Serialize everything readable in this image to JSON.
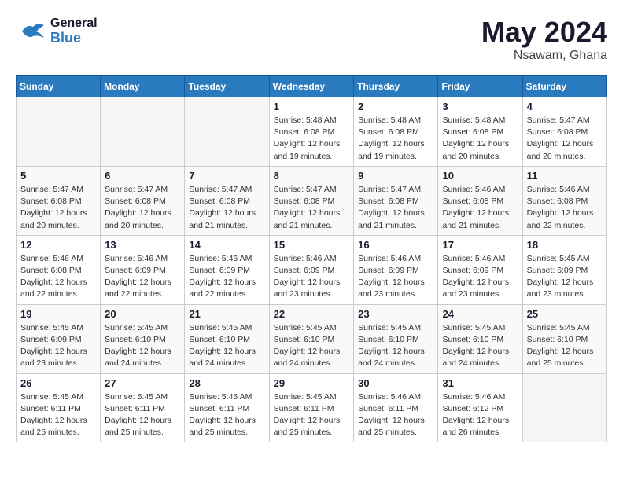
{
  "header": {
    "logo_general": "General",
    "logo_blue": "Blue",
    "month_year": "May 2024",
    "location": "Nsawam, Ghana"
  },
  "days_of_week": [
    "Sunday",
    "Monday",
    "Tuesday",
    "Wednesday",
    "Thursday",
    "Friday",
    "Saturday"
  ],
  "weeks": [
    [
      {
        "day": "",
        "empty": true
      },
      {
        "day": "",
        "empty": true
      },
      {
        "day": "",
        "empty": true
      },
      {
        "day": "1",
        "sunrise": "5:48 AM",
        "sunset": "6:08 PM",
        "daylight": "12 hours and 19 minutes."
      },
      {
        "day": "2",
        "sunrise": "5:48 AM",
        "sunset": "6:08 PM",
        "daylight": "12 hours and 19 minutes."
      },
      {
        "day": "3",
        "sunrise": "5:48 AM",
        "sunset": "6:08 PM",
        "daylight": "12 hours and 20 minutes."
      },
      {
        "day": "4",
        "sunrise": "5:47 AM",
        "sunset": "6:08 PM",
        "daylight": "12 hours and 20 minutes."
      }
    ],
    [
      {
        "day": "5",
        "sunrise": "5:47 AM",
        "sunset": "6:08 PM",
        "daylight": "12 hours and 20 minutes."
      },
      {
        "day": "6",
        "sunrise": "5:47 AM",
        "sunset": "6:08 PM",
        "daylight": "12 hours and 20 minutes."
      },
      {
        "day": "7",
        "sunrise": "5:47 AM",
        "sunset": "6:08 PM",
        "daylight": "12 hours and 21 minutes."
      },
      {
        "day": "8",
        "sunrise": "5:47 AM",
        "sunset": "6:08 PM",
        "daylight": "12 hours and 21 minutes."
      },
      {
        "day": "9",
        "sunrise": "5:47 AM",
        "sunset": "6:08 PM",
        "daylight": "12 hours and 21 minutes."
      },
      {
        "day": "10",
        "sunrise": "5:46 AM",
        "sunset": "6:08 PM",
        "daylight": "12 hours and 21 minutes."
      },
      {
        "day": "11",
        "sunrise": "5:46 AM",
        "sunset": "6:08 PM",
        "daylight": "12 hours and 22 minutes."
      }
    ],
    [
      {
        "day": "12",
        "sunrise": "5:46 AM",
        "sunset": "6:08 PM",
        "daylight": "12 hours and 22 minutes."
      },
      {
        "day": "13",
        "sunrise": "5:46 AM",
        "sunset": "6:09 PM",
        "daylight": "12 hours and 22 minutes."
      },
      {
        "day": "14",
        "sunrise": "5:46 AM",
        "sunset": "6:09 PM",
        "daylight": "12 hours and 22 minutes."
      },
      {
        "day": "15",
        "sunrise": "5:46 AM",
        "sunset": "6:09 PM",
        "daylight": "12 hours and 23 minutes."
      },
      {
        "day": "16",
        "sunrise": "5:46 AM",
        "sunset": "6:09 PM",
        "daylight": "12 hours and 23 minutes."
      },
      {
        "day": "17",
        "sunrise": "5:46 AM",
        "sunset": "6:09 PM",
        "daylight": "12 hours and 23 minutes."
      },
      {
        "day": "18",
        "sunrise": "5:45 AM",
        "sunset": "6:09 PM",
        "daylight": "12 hours and 23 minutes."
      }
    ],
    [
      {
        "day": "19",
        "sunrise": "5:45 AM",
        "sunset": "6:09 PM",
        "daylight": "12 hours and 23 minutes."
      },
      {
        "day": "20",
        "sunrise": "5:45 AM",
        "sunset": "6:10 PM",
        "daylight": "12 hours and 24 minutes."
      },
      {
        "day": "21",
        "sunrise": "5:45 AM",
        "sunset": "6:10 PM",
        "daylight": "12 hours and 24 minutes."
      },
      {
        "day": "22",
        "sunrise": "5:45 AM",
        "sunset": "6:10 PM",
        "daylight": "12 hours and 24 minutes."
      },
      {
        "day": "23",
        "sunrise": "5:45 AM",
        "sunset": "6:10 PM",
        "daylight": "12 hours and 24 minutes."
      },
      {
        "day": "24",
        "sunrise": "5:45 AM",
        "sunset": "6:10 PM",
        "daylight": "12 hours and 24 minutes."
      },
      {
        "day": "25",
        "sunrise": "5:45 AM",
        "sunset": "6:10 PM",
        "daylight": "12 hours and 25 minutes."
      }
    ],
    [
      {
        "day": "26",
        "sunrise": "5:45 AM",
        "sunset": "6:11 PM",
        "daylight": "12 hours and 25 minutes."
      },
      {
        "day": "27",
        "sunrise": "5:45 AM",
        "sunset": "6:11 PM",
        "daylight": "12 hours and 25 minutes."
      },
      {
        "day": "28",
        "sunrise": "5:45 AM",
        "sunset": "6:11 PM",
        "daylight": "12 hours and 25 minutes."
      },
      {
        "day": "29",
        "sunrise": "5:45 AM",
        "sunset": "6:11 PM",
        "daylight": "12 hours and 25 minutes."
      },
      {
        "day": "30",
        "sunrise": "5:46 AM",
        "sunset": "6:11 PM",
        "daylight": "12 hours and 25 minutes."
      },
      {
        "day": "31",
        "sunrise": "5:46 AM",
        "sunset": "6:12 PM",
        "daylight": "12 hours and 26 minutes."
      },
      {
        "day": "",
        "empty": true
      }
    ]
  ]
}
